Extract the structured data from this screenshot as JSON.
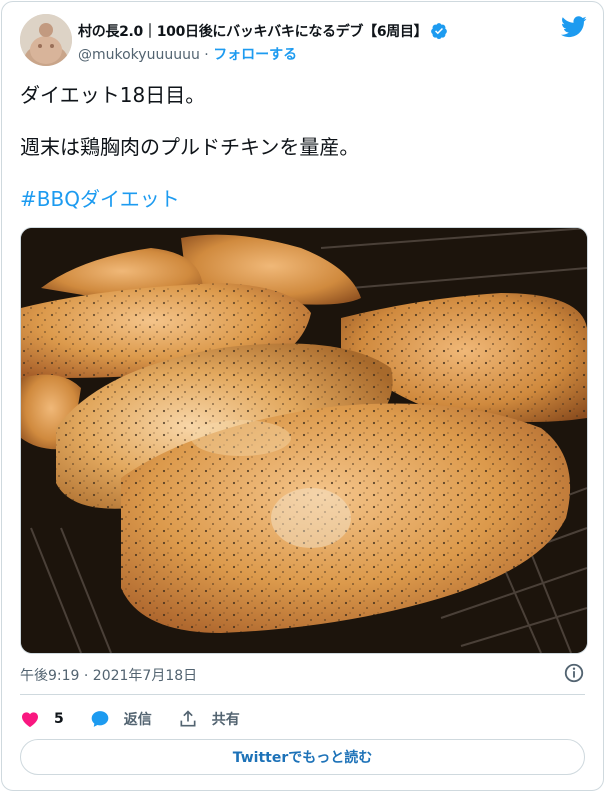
{
  "user": {
    "display_name": "村の長2.0｜100日後にバッキバキになるデブ【6周目】",
    "handle": "@mukokyuuuuuu",
    "separator": " · ",
    "follow_label": "フォローする"
  },
  "tweet": {
    "line1": "ダイエット18日目。",
    "line2": "週末は鶏胸肉のプルドチキンを量産。",
    "hashtag": "#BBQダイエット",
    "timestamp": "午後9:19 · 2021年7月18日"
  },
  "actions": {
    "like_count": "5",
    "reply_label": "返信",
    "share_label": "共有"
  },
  "read_more_label": "Twitterでもっと読む",
  "colors": {
    "accent": "#1d9bf0",
    "like": "#f91880",
    "text": "#0f1419",
    "muted": "#536471"
  }
}
